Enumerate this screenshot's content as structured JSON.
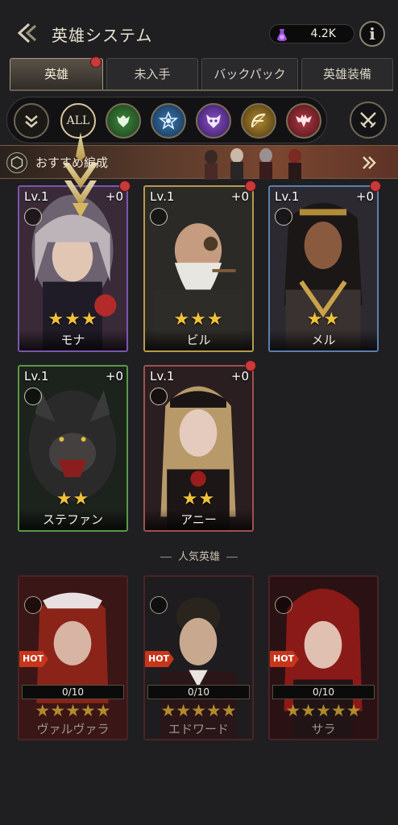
{
  "header": {
    "title": "英雄システム",
    "currency_amount": "4.2K",
    "info_label": "i"
  },
  "tabs": [
    {
      "label": "英雄",
      "active": true,
      "badge": true
    },
    {
      "label": "未入手",
      "active": false,
      "badge": false
    },
    {
      "label": "バックパック",
      "active": false,
      "badge": false
    },
    {
      "label": "英雄装備",
      "active": false,
      "badge": false
    }
  ],
  "filters": {
    "collapse_icon": "double-chevron-down-icon",
    "all_label": "ALL",
    "types": [
      {
        "icon": "wolf-icon",
        "color": "#2f6b2f"
      },
      {
        "icon": "eye-star-icon",
        "color": "#2a5f8e"
      },
      {
        "icon": "demon-mask-icon",
        "color": "#6a3aa0"
      },
      {
        "icon": "bow-icon",
        "color": "#8a6a20"
      },
      {
        "icon": "bat-wings-icon",
        "color": "#8a2a30"
      }
    ],
    "battle_icon": "crossed-swords-icon"
  },
  "recommended": {
    "label": "おすすめ編成"
  },
  "heroes": [
    {
      "name": "モナ",
      "level": "Lv.1",
      "plus": "+0",
      "stars": 3,
      "border": "#7a56b0",
      "class_icon": "class-icon",
      "badge": true
    },
    {
      "name": "ビル",
      "level": "Lv.1",
      "plus": "+0",
      "stars": 3,
      "border": "#b99a4a",
      "class_icon": "crosshair-icon",
      "badge": true
    },
    {
      "name": "メル",
      "level": "Lv.1",
      "plus": "+0",
      "stars": 2,
      "border": "#5a7fb0",
      "class_icon": "class-icon",
      "badge": true
    },
    {
      "name": "ステファン",
      "level": "Lv.1",
      "plus": "+0",
      "stars": 2,
      "border": "#5a9a45",
      "class_icon": "shield-icon",
      "badge": false
    },
    {
      "name": "アニー",
      "level": "Lv.1",
      "plus": "+0",
      "stars": 2,
      "border": "#a05050",
      "class_icon": "crosshair-icon",
      "badge": true
    }
  ],
  "popular_section": {
    "title": "人気英雄"
  },
  "popular": [
    {
      "name": "ヴァルヴァラ",
      "hot": "HOT",
      "progress": "0/10",
      "stars": 5
    },
    {
      "name": "エドワード",
      "hot": "HOT",
      "progress": "0/10",
      "stars": 5
    },
    {
      "name": "サラ",
      "hot": "HOT",
      "progress": "0/10",
      "stars": 5
    }
  ]
}
